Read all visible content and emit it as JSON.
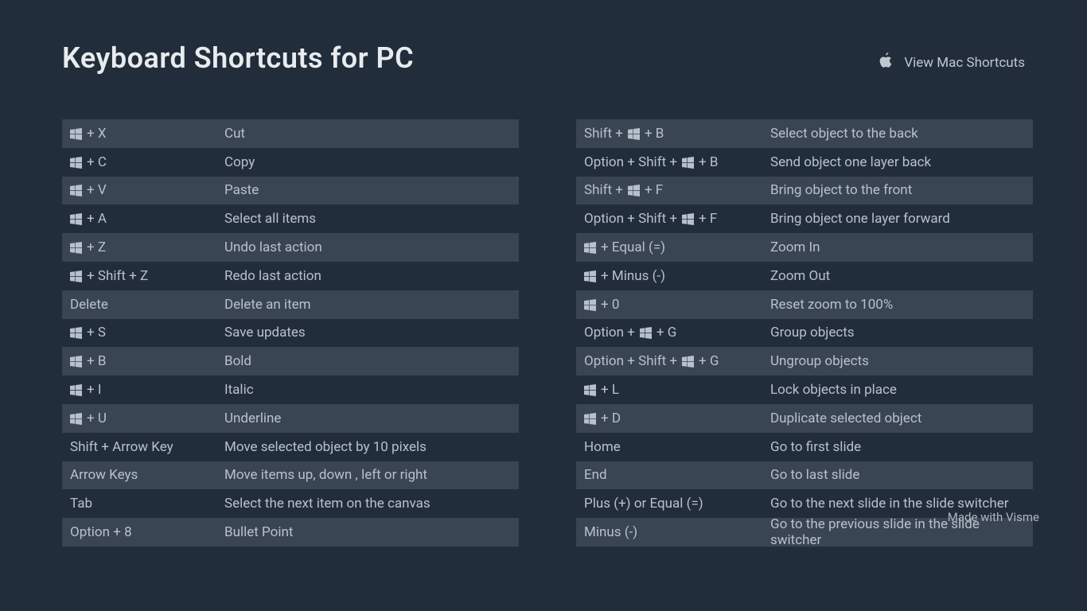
{
  "header": {
    "title": "Keyboard Shortcuts for PC",
    "mac_link": "View Mac Shortcuts"
  },
  "left": [
    {
      "keys": [
        {
          "t": "win"
        },
        {
          "t": "text",
          "v": " + X"
        }
      ],
      "desc": "Cut"
    },
    {
      "keys": [
        {
          "t": "win"
        },
        {
          "t": "text",
          "v": " + C"
        }
      ],
      "desc": "Copy"
    },
    {
      "keys": [
        {
          "t": "win"
        },
        {
          "t": "text",
          "v": " + V"
        }
      ],
      "desc": "Paste"
    },
    {
      "keys": [
        {
          "t": "win"
        },
        {
          "t": "text",
          "v": " + A"
        }
      ],
      "desc": "Select all items"
    },
    {
      "keys": [
        {
          "t": "win"
        },
        {
          "t": "text",
          "v": " + Z"
        }
      ],
      "desc": "Undo last action"
    },
    {
      "keys": [
        {
          "t": "win"
        },
        {
          "t": "text",
          "v": " + Shift + Z"
        }
      ],
      "desc": "Redo last action"
    },
    {
      "keys": [
        {
          "t": "text",
          "v": "Delete"
        }
      ],
      "desc": "Delete an item"
    },
    {
      "keys": [
        {
          "t": "win"
        },
        {
          "t": "text",
          "v": " + S"
        }
      ],
      "desc": "Save updates"
    },
    {
      "keys": [
        {
          "t": "win"
        },
        {
          "t": "text",
          "v": " + B"
        }
      ],
      "desc": "Bold"
    },
    {
      "keys": [
        {
          "t": "win"
        },
        {
          "t": "text",
          "v": " + I"
        }
      ],
      "desc": "Italic"
    },
    {
      "keys": [
        {
          "t": "win"
        },
        {
          "t": "text",
          "v": " + U"
        }
      ],
      "desc": "Underline"
    },
    {
      "keys": [
        {
          "t": "text",
          "v": "Shift + Arrow Key"
        }
      ],
      "desc": "Move selected object by 10 pixels"
    },
    {
      "keys": [
        {
          "t": "text",
          "v": "Arrow Keys"
        }
      ],
      "desc": "Move items up, down , left or right"
    },
    {
      "keys": [
        {
          "t": "text",
          "v": "Tab"
        }
      ],
      "desc": "Select the next item on the canvas"
    },
    {
      "keys": [
        {
          "t": "text",
          "v": "Option + 8"
        }
      ],
      "desc": "Bullet Point"
    }
  ],
  "right": [
    {
      "keys": [
        {
          "t": "text",
          "v": "Shift + "
        },
        {
          "t": "win"
        },
        {
          "t": "text",
          "v": " + B"
        }
      ],
      "desc": "Select object to the back"
    },
    {
      "keys": [
        {
          "t": "text",
          "v": "Option + Shift + "
        },
        {
          "t": "win"
        },
        {
          "t": "text",
          "v": " + B"
        }
      ],
      "desc": "Send object one layer back"
    },
    {
      "keys": [
        {
          "t": "text",
          "v": "Shift + "
        },
        {
          "t": "win"
        },
        {
          "t": "text",
          "v": " + F"
        }
      ],
      "desc": "Bring object to the front"
    },
    {
      "keys": [
        {
          "t": "text",
          "v": "Option + Shift + "
        },
        {
          "t": "win"
        },
        {
          "t": "text",
          "v": "+ F"
        }
      ],
      "desc": "Bring object one layer forward"
    },
    {
      "keys": [
        {
          "t": "win"
        },
        {
          "t": "text",
          "v": " + Equal (=)"
        }
      ],
      "desc": "Zoom In"
    },
    {
      "keys": [
        {
          "t": "win"
        },
        {
          "t": "text",
          "v": " + Minus (-)"
        }
      ],
      "desc": "Zoom Out"
    },
    {
      "keys": [
        {
          "t": "win"
        },
        {
          "t": "text",
          "v": " + 0"
        }
      ],
      "desc": "Reset zoom to 100%"
    },
    {
      "keys": [
        {
          "t": "text",
          "v": "Option + "
        },
        {
          "t": "win"
        },
        {
          "t": "text",
          "v": " + G"
        }
      ],
      "desc": "Group objects"
    },
    {
      "keys": [
        {
          "t": "text",
          "v": "Option + Shift + "
        },
        {
          "t": "win"
        },
        {
          "t": "text",
          "v": " + G"
        }
      ],
      "desc": "Ungroup objects"
    },
    {
      "keys": [
        {
          "t": "win"
        },
        {
          "t": "text",
          "v": " + L"
        }
      ],
      "desc": "Lock objects in place"
    },
    {
      "keys": [
        {
          "t": "win"
        },
        {
          "t": "text",
          "v": " + D"
        }
      ],
      "desc": "Duplicate selected object"
    },
    {
      "keys": [
        {
          "t": "text",
          "v": "Home"
        }
      ],
      "desc": "Go to first slide"
    },
    {
      "keys": [
        {
          "t": "text",
          "v": "End"
        }
      ],
      "desc": "Go to last slide"
    },
    {
      "keys": [
        {
          "t": "text",
          "v": "Plus (+) or Equal (=)"
        }
      ],
      "desc": "Go to the next slide in the slide switcher"
    },
    {
      "keys": [
        {
          "t": "text",
          "v": "Minus (-)"
        }
      ],
      "desc": "Go to the previous slide in the slide switcher"
    }
  ],
  "footer": "Made with Visme"
}
